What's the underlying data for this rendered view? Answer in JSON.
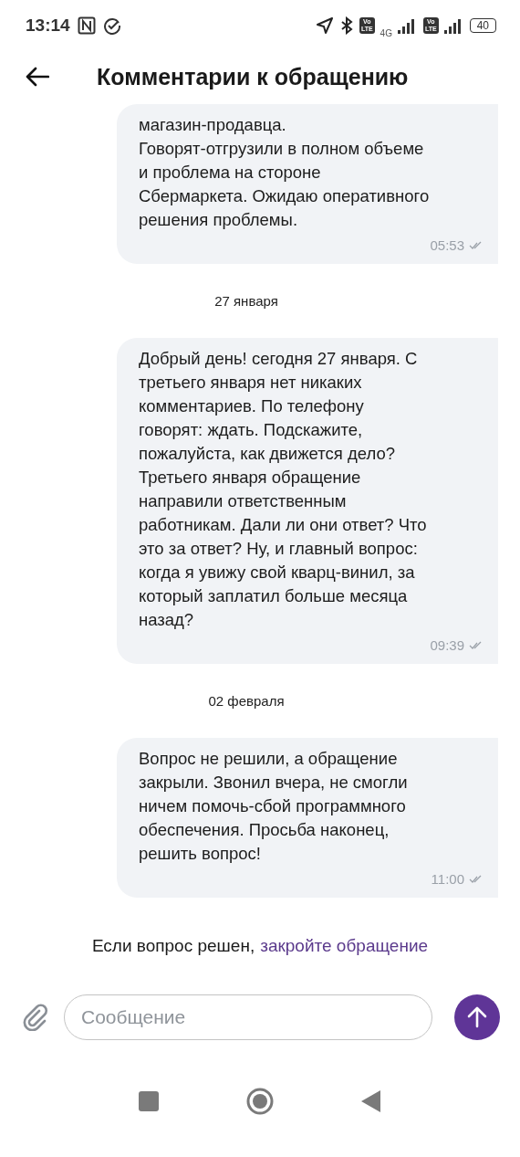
{
  "status_bar": {
    "time": "13:14",
    "volte_badges": [
      {
        "top": "Vo",
        "bottom": "LTE"
      },
      {
        "top": "Vo",
        "bottom": "LTE"
      }
    ],
    "network": "4G",
    "battery": "40"
  },
  "header": {
    "title": "Комментарии к обращению"
  },
  "feed": [
    {
      "kind": "message",
      "text": "магазин-продавца.\nГоворят-отгрузили в полном объеме\nи проблема на стороне\nСбермаркета. Ожидаю оперативного\nрешения проблемы.",
      "time": "05:53",
      "read": true
    },
    {
      "kind": "date",
      "text": "27 января"
    },
    {
      "kind": "message",
      "text": "Добрый день! сегодня 27 января. С\nтретьего января нет никаких\nкомментариев. По телефону\nговорят: ждать. Подскажите,\nпожалуйста, как движется дело?\nТретьего января обращение\nнаправили ответственным\nработникам. Дали ли они ответ? Что\nэто за ответ? Ну, и главный вопрос:\nкогда я увижу свой кварц-винил, за\nкоторый заплатил больше месяца\nназад?",
      "time": "09:39",
      "read": true
    },
    {
      "kind": "date",
      "text": "02 февраля"
    },
    {
      "kind": "message",
      "text": "Вопрос не решили, а обращение\nзакрыли. Звонил вчера, не смогли\nничем помочь-сбой программного\nобеспечения. Просьба наконец,\nрешить вопрос!",
      "time": "11:00",
      "read": true
    }
  ],
  "close_hint": {
    "text": "Если вопрос решен,",
    "link": "закройте обращение"
  },
  "composer": {
    "placeholder": "Сообщение"
  }
}
